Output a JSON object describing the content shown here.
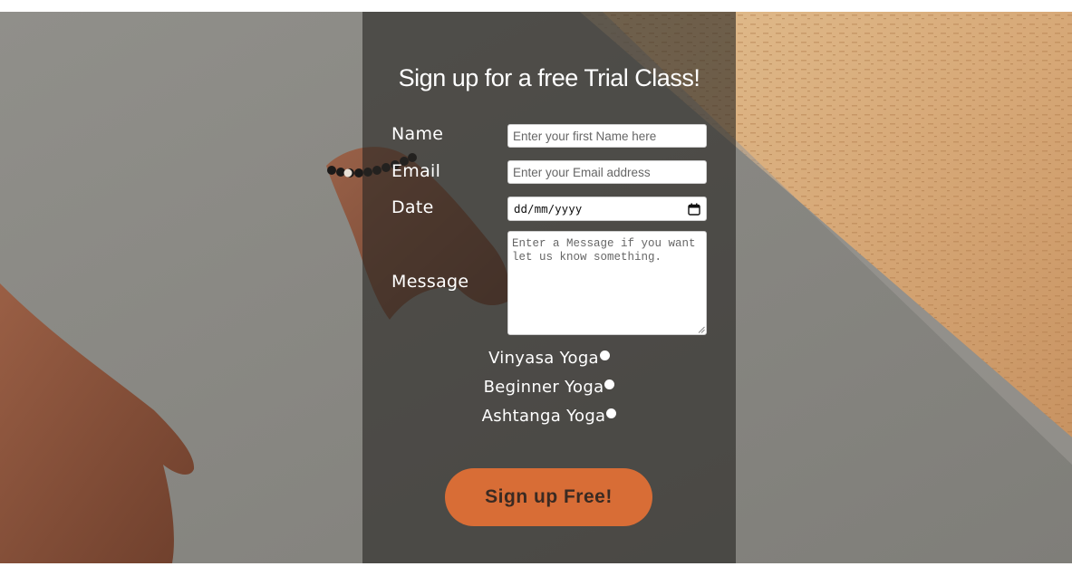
{
  "form": {
    "title": "Sign up for a free Trial Class!",
    "name_label": "Name",
    "name_placeholder": "Enter your first Name here",
    "email_label": "Email",
    "email_placeholder": "Enter your Email address",
    "date_label": "Date",
    "date_value": "dd/mm/yyyy",
    "message_label": "Message",
    "message_placeholder": "Enter a Message if you want let us know something.",
    "class_options": [
      {
        "label": "Vinyasa Yoga"
      },
      {
        "label": "Beginner Yoga"
      },
      {
        "label": "Ashtanga Yoga"
      }
    ],
    "submit_label": "Sign up Free!"
  },
  "icons": {
    "date_picker": "calendar-icon",
    "radio": "radio-dot-icon",
    "resize": "resize-grip-icon"
  },
  "colors": {
    "accent": "#d86d36",
    "panel_overlay": "rgba(40,38,36,0.62)",
    "text_light": "#ffffff"
  }
}
